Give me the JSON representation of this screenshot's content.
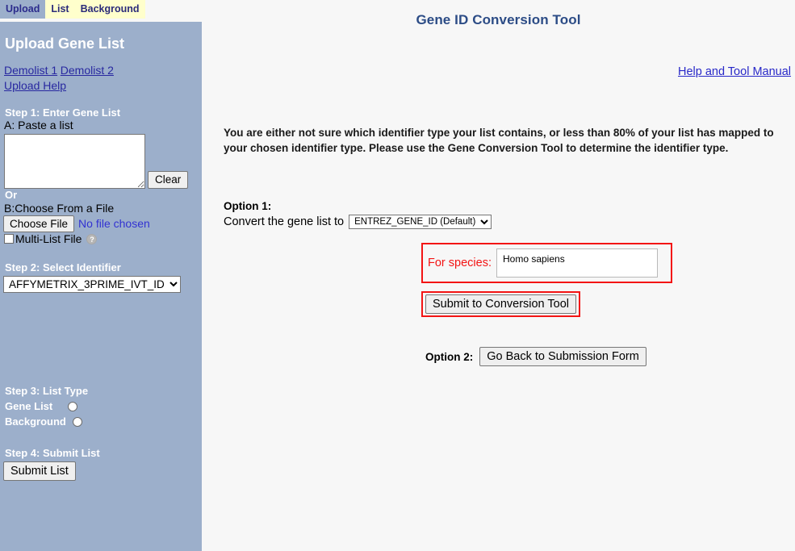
{
  "tabs": [
    {
      "label": "Upload",
      "active": true
    },
    {
      "label": "List",
      "active": false
    },
    {
      "label": "Background",
      "active": false
    }
  ],
  "sidebar": {
    "title": "Upload Gene List",
    "links": [
      {
        "label": "Demolist 1"
      },
      {
        "label": "Demolist 2"
      },
      {
        "label": "Upload Help"
      }
    ],
    "step1": {
      "heading": "Step 1: Enter Gene List",
      "paste_label": "A: Paste a list",
      "textarea_value": "",
      "textarea_placeholder": "",
      "clear_label": "Clear",
      "or_label": "Or",
      "file_label": "B:Choose From a File",
      "choose_file_label": "Choose File",
      "no_file_text": "No file chosen",
      "multi_list_label": "Multi-List File",
      "multi_list_checked": false,
      "help_icon_glyph": "?"
    },
    "step2": {
      "heading": "Step 2: Select Identifier",
      "selected": "AFFYMETRIX_3PRIME_IVT_ID",
      "options": [
        "AFFYMETRIX_3PRIME_IVT_ID"
      ]
    },
    "step3": {
      "heading": "Step 3: List Type",
      "radios": [
        {
          "label": "Gene List",
          "checked": false
        },
        {
          "label": "Background",
          "checked": false
        }
      ]
    },
    "step4": {
      "heading": "Step 4: Submit List",
      "submit_label": "Submit List"
    }
  },
  "main": {
    "title": "Gene ID Conversion Tool",
    "help_link": "Help and Tool Manual",
    "notice": "You are either not sure which identifier type your list contains, or less than 80% of your list has mapped to your chosen identifier type. Please use the Gene Conversion Tool to determine the identifier type.",
    "option1": {
      "label": "Option 1:",
      "convert_text": "Convert the gene list to",
      "convert_selected": "ENTREZ_GENE_ID (Default)",
      "convert_options": [
        "ENTREZ_GENE_ID (Default)"
      ],
      "species_label": "For species:",
      "species_options": [
        "Homo sapiens"
      ],
      "submit_label": "Submit to Conversion Tool"
    },
    "option2": {
      "label": "Option 2:",
      "button_label": "Go Back to Submission Form"
    }
  },
  "colors": {
    "sidebar_bg": "#9CAFCB",
    "tab_inactive_bg": "#FFFFCC",
    "page_bg": "#F7F7F7",
    "title_blue": "#2C4C86",
    "link_blue": "#2828C8",
    "alert_red": "#F31414"
  }
}
